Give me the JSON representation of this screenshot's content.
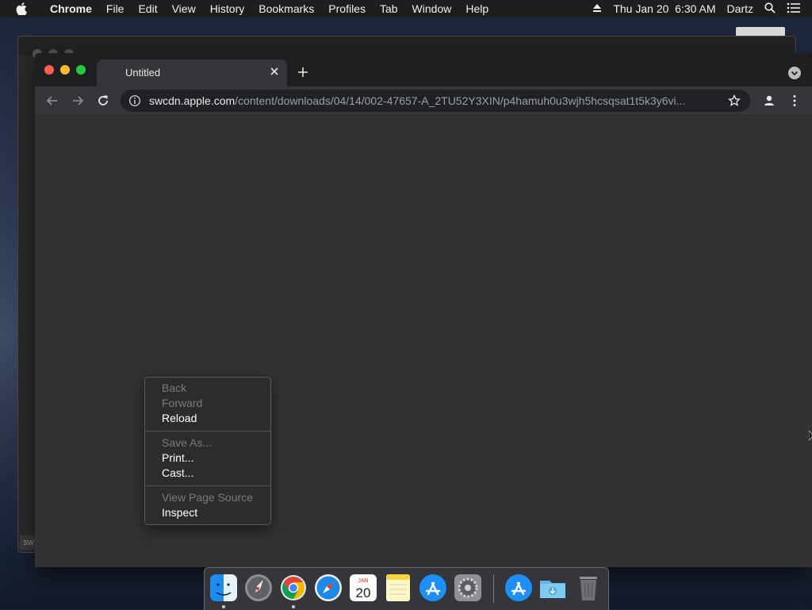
{
  "menubar": {
    "app_name": "Chrome",
    "menus": [
      "File",
      "Edit",
      "View",
      "History",
      "Bookmarks",
      "Profiles",
      "Tab",
      "Window",
      "Help"
    ],
    "clock": "Thu Jan 20  6:30 AM",
    "user": "Dartz",
    "icons": [
      "apple-icon",
      "eject-icon",
      "spotlight-search-icon",
      "control-center-icon"
    ]
  },
  "background_window": {
    "footer_text": "sw"
  },
  "browser": {
    "tab_title": "Untitled",
    "url_host": "swcdn.apple.com",
    "url_path": "/content/downloads/04/14/002-47657-A_2TU52Y3XIN/p4hamuh0u3wjh5hcsqsat1t5k3y6vi..."
  },
  "context_menu": {
    "groups": [
      [
        {
          "label": "Back",
          "enabled": false
        },
        {
          "label": "Forward",
          "enabled": false
        },
        {
          "label": "Reload",
          "enabled": true
        }
      ],
      [
        {
          "label": "Save As...",
          "enabled": false
        },
        {
          "label": "Print...",
          "enabled": true
        },
        {
          "label": "Cast...",
          "enabled": true
        }
      ],
      [
        {
          "label": "View Page Source",
          "enabled": false
        },
        {
          "label": "Inspect",
          "enabled": true
        }
      ]
    ]
  },
  "dock": {
    "calendar_month": "JAN",
    "calendar_day": "20",
    "apps": [
      "finder-icon",
      "launchpad-icon",
      "chrome-icon",
      "safari-icon",
      "calendar-icon",
      "notes-icon",
      "app-store-icon",
      "system-preferences-icon",
      "app-store-icon",
      "downloads-folder-icon",
      "trash-icon"
    ]
  },
  "colors": {
    "menubar_bg": "#1e1e1f",
    "window_bg": "#323235",
    "tab_active_bg": "#35363a",
    "omnibox_bg": "#202124",
    "close_red": "#ff5f57",
    "minimize_yellow": "#febc2e",
    "maximize_green": "#28c840"
  }
}
